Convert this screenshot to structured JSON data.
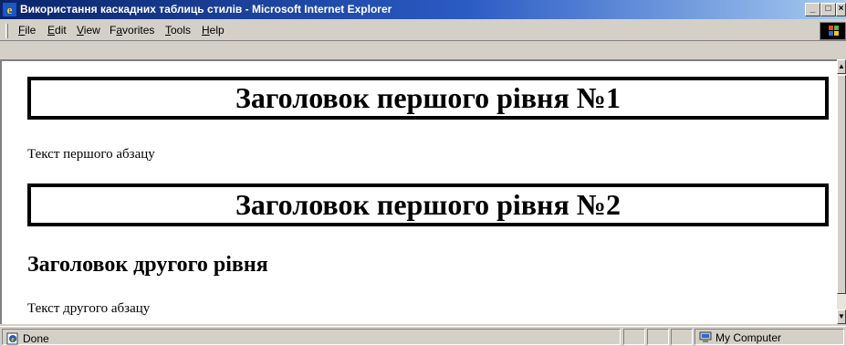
{
  "window": {
    "title": "Використання каскадних таблиць стилів - Microsoft Internet Explorer",
    "minimize_label": "_",
    "maximize_label": "□",
    "close_label": "×"
  },
  "menu": {
    "items": [
      {
        "u": "F",
        "rest": "ile"
      },
      {
        "u": "E",
        "rest": "dit"
      },
      {
        "u": "V",
        "rest": "iew"
      },
      {
        "pre": "F",
        "u": "a",
        "rest": "vorites"
      },
      {
        "u": "T",
        "rest": "ools"
      },
      {
        "u": "H",
        "rest": "elp"
      }
    ]
  },
  "document": {
    "h1_first": "Заголовок першого рівня №1",
    "para_first": "Текст першого абзацу",
    "h1_second": "Заголовок першого рівня №2",
    "h2": "Заголовок другого рівня",
    "para_second": "Текст другого абзацу"
  },
  "status": {
    "text": "Done",
    "zone": "My Computer"
  },
  "colors": {
    "title_bar_start": "#0a246a",
    "title_bar_end": "#a6caf0",
    "chrome": "#d4d0c8",
    "content_bg": "#ffffff"
  },
  "icons": {
    "app": "ie-logo-icon",
    "status": "page-done-icon",
    "zone": "computer-icon",
    "throbber": "windows-flag-icon"
  }
}
